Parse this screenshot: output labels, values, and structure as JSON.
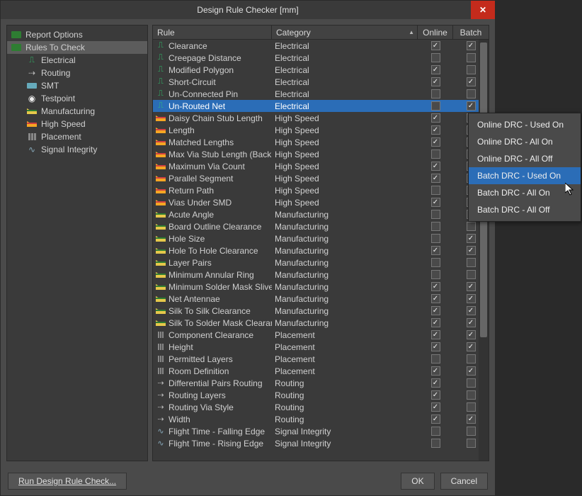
{
  "window": {
    "title": "Design Rule Checker [mm]"
  },
  "tree": {
    "items": [
      {
        "label": "Report Options",
        "icon": "folder"
      },
      {
        "label": "Rules To Check",
        "icon": "folder",
        "selected": true
      },
      {
        "label": "Electrical",
        "icon": "elec",
        "child": true
      },
      {
        "label": "Routing",
        "icon": "route",
        "child": true
      },
      {
        "label": "SMT",
        "icon": "smt",
        "child": true
      },
      {
        "label": "Testpoint",
        "icon": "tp",
        "child": true
      },
      {
        "label": "Manufacturing",
        "icon": "mfg",
        "child": true
      },
      {
        "label": "High Speed",
        "icon": "hs",
        "child": true
      },
      {
        "label": "Placement",
        "icon": "place",
        "child": true
      },
      {
        "label": "Signal Integrity",
        "icon": "sig",
        "child": true
      }
    ]
  },
  "grid": {
    "headers": {
      "rule": "Rule",
      "category": "Category",
      "online": "Online",
      "batch": "Batch"
    },
    "rows": [
      {
        "rule": "Clearance",
        "cat": "Electrical",
        "icon": "elec",
        "online": true,
        "batch": true
      },
      {
        "rule": "Creepage Distance",
        "cat": "Electrical",
        "icon": "elec",
        "online": false,
        "batch": false
      },
      {
        "rule": "Modified Polygon",
        "cat": "Electrical",
        "icon": "elec",
        "online": true,
        "batch": false
      },
      {
        "rule": "Short-Circuit",
        "cat": "Electrical",
        "icon": "elec",
        "online": true,
        "batch": true
      },
      {
        "rule": "Un-Connected Pin",
        "cat": "Electrical",
        "icon": "elec",
        "online": false,
        "batch": false
      },
      {
        "rule": "Un-Routed Net",
        "cat": "Electrical",
        "icon": "elec",
        "online": false,
        "batch": true,
        "selected": true
      },
      {
        "rule": "Daisy Chain Stub Length",
        "cat": "High Speed",
        "icon": "hs",
        "online": true,
        "batch": true
      },
      {
        "rule": "Length",
        "cat": "High Speed",
        "icon": "hs",
        "online": true,
        "batch": true
      },
      {
        "rule": "Matched Lengths",
        "cat": "High Speed",
        "icon": "hs",
        "online": true,
        "batch": true
      },
      {
        "rule": "Max Via Stub Length (Back D",
        "cat": "High Speed",
        "icon": "hs",
        "online": false,
        "batch": false
      },
      {
        "rule": "Maximum Via Count",
        "cat": "High Speed",
        "icon": "hs",
        "online": true,
        "batch": true
      },
      {
        "rule": "Parallel Segment",
        "cat": "High Speed",
        "icon": "hs",
        "online": true,
        "batch": true
      },
      {
        "rule": "Return Path",
        "cat": "High Speed",
        "icon": "hs",
        "online": false,
        "batch": false
      },
      {
        "rule": "Vias Under SMD",
        "cat": "High Speed",
        "icon": "hs",
        "online": true,
        "batch": true
      },
      {
        "rule": "Acute Angle",
        "cat": "Manufacturing",
        "icon": "mfg",
        "online": false,
        "batch": false
      },
      {
        "rule": "Board Outline Clearance",
        "cat": "Manufacturing",
        "icon": "mfg",
        "online": false,
        "batch": false
      },
      {
        "rule": "Hole Size",
        "cat": "Manufacturing",
        "icon": "mfg",
        "online": false,
        "batch": true
      },
      {
        "rule": "Hole To Hole Clearance",
        "cat": "Manufacturing",
        "icon": "mfg",
        "online": true,
        "batch": true
      },
      {
        "rule": "Layer Pairs",
        "cat": "Manufacturing",
        "icon": "mfg",
        "online": false,
        "batch": false
      },
      {
        "rule": "Minimum Annular Ring",
        "cat": "Manufacturing",
        "icon": "mfg",
        "online": false,
        "batch": false
      },
      {
        "rule": "Minimum Solder Mask Sliver",
        "cat": "Manufacturing",
        "icon": "mfg",
        "online": true,
        "batch": true
      },
      {
        "rule": "Net Antennae",
        "cat": "Manufacturing",
        "icon": "mfg",
        "online": true,
        "batch": true
      },
      {
        "rule": "Silk To Silk Clearance",
        "cat": "Manufacturing",
        "icon": "mfg",
        "online": true,
        "batch": true
      },
      {
        "rule": "Silk To Solder Mask Clearanc",
        "cat": "Manufacturing",
        "icon": "mfg",
        "online": true,
        "batch": true
      },
      {
        "rule": "Component Clearance",
        "cat": "Placement",
        "icon": "place",
        "online": true,
        "batch": true
      },
      {
        "rule": "Height",
        "cat": "Placement",
        "icon": "place",
        "online": true,
        "batch": true
      },
      {
        "rule": "Permitted Layers",
        "cat": "Placement",
        "icon": "place",
        "online": false,
        "batch": false
      },
      {
        "rule": "Room Definition",
        "cat": "Placement",
        "icon": "place",
        "online": true,
        "batch": true
      },
      {
        "rule": "Differential Pairs Routing",
        "cat": "Routing",
        "icon": "route",
        "online": true,
        "batch": false
      },
      {
        "rule": "Routing Layers",
        "cat": "Routing",
        "icon": "route",
        "online": true,
        "batch": false
      },
      {
        "rule": "Routing Via Style",
        "cat": "Routing",
        "icon": "route",
        "online": true,
        "batch": false
      },
      {
        "rule": "Width",
        "cat": "Routing",
        "icon": "route",
        "online": true,
        "batch": true
      },
      {
        "rule": "Flight Time - Falling Edge",
        "cat": "Signal Integrity",
        "icon": "sig",
        "online": false,
        "batch": false
      },
      {
        "rule": "Flight Time - Rising Edge",
        "cat": "Signal Integrity",
        "icon": "sig",
        "online": false,
        "batch": false
      }
    ]
  },
  "footer": {
    "run": "Run Design Rule Check...",
    "ok": "OK",
    "cancel": "Cancel"
  },
  "context_menu": {
    "items": [
      {
        "label": "Online DRC - Used On"
      },
      {
        "label": "Online DRC - All On"
      },
      {
        "label": "Online DRC - All Off"
      },
      {
        "label": "Batch DRC - Used On",
        "hover": true
      },
      {
        "label": "Batch DRC - All On"
      },
      {
        "label": "Batch DRC - All Off"
      }
    ]
  }
}
